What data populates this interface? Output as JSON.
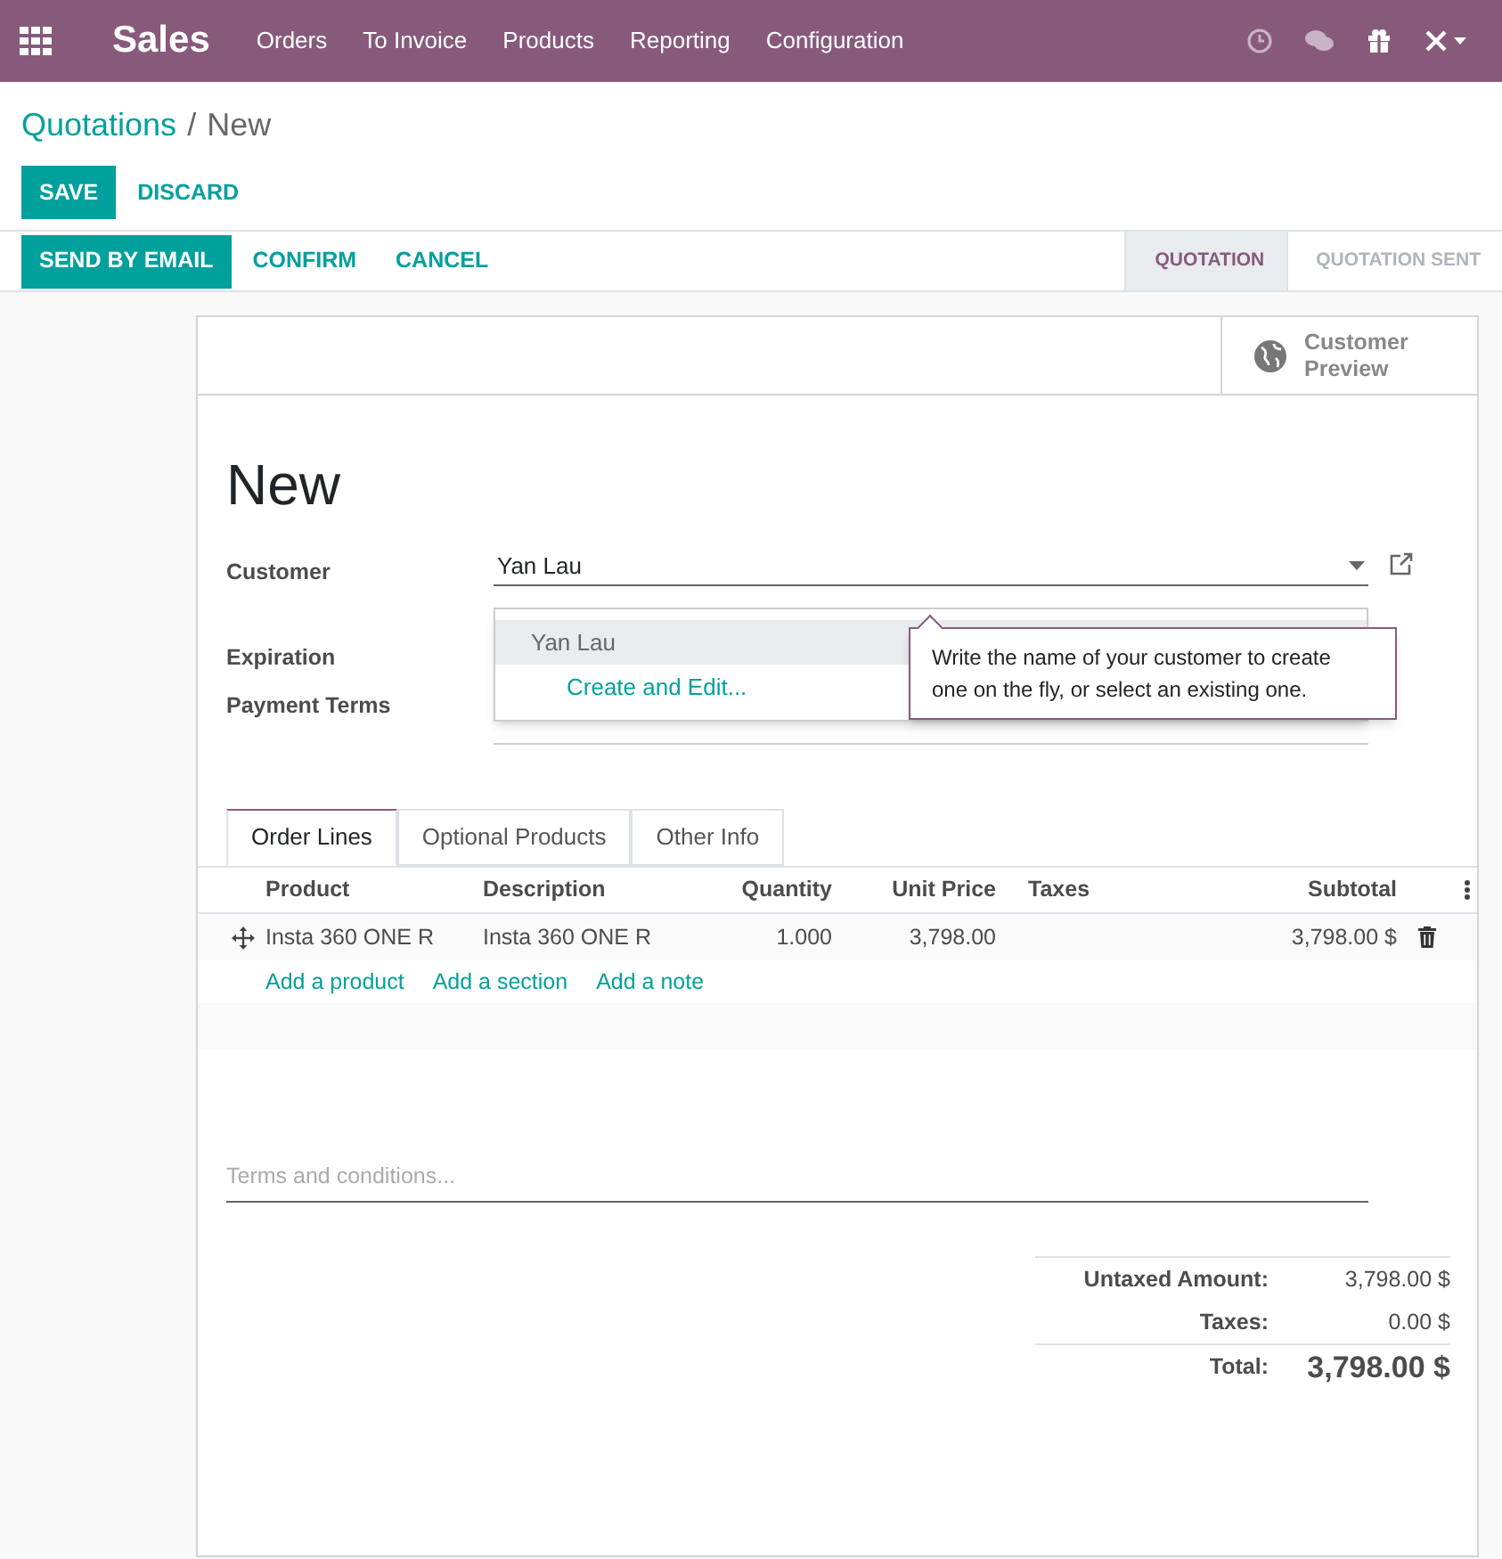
{
  "navbar": {
    "app_title": "Sales",
    "menu": [
      "Orders",
      "To Invoice",
      "Products",
      "Reporting",
      "Configuration"
    ]
  },
  "breadcrumb": {
    "parent": "Quotations",
    "separator": "/",
    "current": "New"
  },
  "actions": [
    {
      "label": "SAVE",
      "kind": "primary"
    },
    {
      "label": "DISCARD",
      "kind": "link"
    }
  ],
  "header_buttons": [
    {
      "label": "SEND BY EMAIL",
      "kind": "primary"
    },
    {
      "label": "CONFIRM",
      "kind": "link"
    },
    {
      "label": "CANCEL",
      "kind": "link"
    }
  ],
  "status_steps": [
    {
      "label": "QUOTATION",
      "selected": true
    },
    {
      "label": "QUOTATION SENT",
      "selected": false
    }
  ],
  "smart_button": {
    "label": "Customer Preview"
  },
  "title": "New",
  "fields": [
    {
      "label": "Customer",
      "value": "Yan Lau"
    },
    {
      "label": "Expiration"
    },
    {
      "label": "Payment Terms"
    }
  ],
  "autocomplete": {
    "items": [
      {
        "label": "Yan Lau",
        "kind": "option",
        "selected": true
      },
      {
        "label": "Create and Edit...",
        "kind": "action",
        "selected": false
      }
    ]
  },
  "tooltip": "Write the name of your customer to create one on the fly, or select an existing one.",
  "tabs": [
    {
      "label": "Order Lines",
      "selected": true
    },
    {
      "label": "Optional Products",
      "selected": false
    },
    {
      "label": "Other Info",
      "selected": false
    }
  ],
  "table": {
    "columns": [
      "Product",
      "Description",
      "Quantity",
      "Unit Price",
      "Taxes",
      "Subtotal"
    ],
    "rows": [
      {
        "product": "Insta 360 ONE R",
        "description": "Insta 360 ONE R",
        "quantity": "1.000",
        "unit_price": "3,798.00",
        "taxes": "",
        "subtotal": "3,798.00 $"
      }
    ],
    "add_links": [
      "Add a product",
      "Add a section",
      "Add a note"
    ]
  },
  "terms": {
    "placeholder": "Terms and conditions..."
  },
  "totals": [
    {
      "label": "Untaxed Amount:",
      "value": "3,798.00 $",
      "kind": "normal"
    },
    {
      "label": "Taxes:",
      "value": "0.00 $",
      "kind": "normal"
    },
    {
      "label": "Total:",
      "value": "3,798.00 $",
      "kind": "grand"
    }
  ]
}
